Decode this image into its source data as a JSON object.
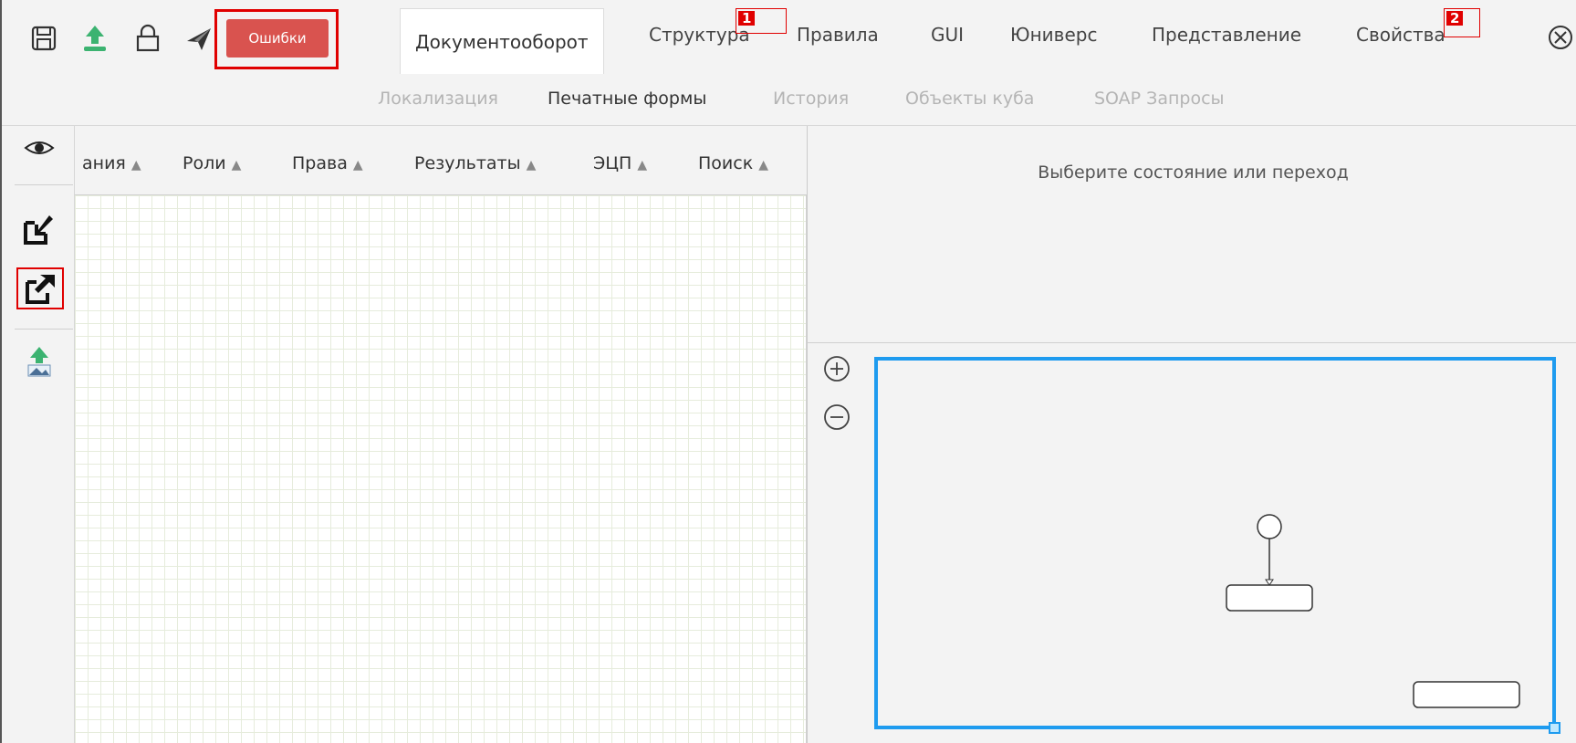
{
  "toolbar": {
    "errors_label": "Ошибки",
    "tabs": [
      "Документооборот",
      "Структура",
      "Правила",
      "GUI",
      "Юниверс",
      "Представление",
      "Свойства"
    ],
    "subtabs": [
      "Локализация",
      "Печатные формы",
      "История",
      "Объекты куба",
      "SOAP Запросы"
    ],
    "markers": [
      "1",
      "2"
    ],
    "icons": [
      "save-icon",
      "upload-icon",
      "lock-icon",
      "send-icon",
      "close-icon"
    ]
  },
  "columns": [
    "ания",
    "Роли",
    "Права",
    "Результаты",
    "ЭЦП",
    "Поиск"
  ],
  "sidebar_icons": [
    "eye-icon",
    "import-icon",
    "export-icon",
    "image-upload-icon"
  ],
  "properties": {
    "placeholder": "Выберите состояние или переход"
  },
  "colors": {
    "accent": "#1e9bef",
    "error": "#d9534f",
    "upload": "#3cb371"
  }
}
